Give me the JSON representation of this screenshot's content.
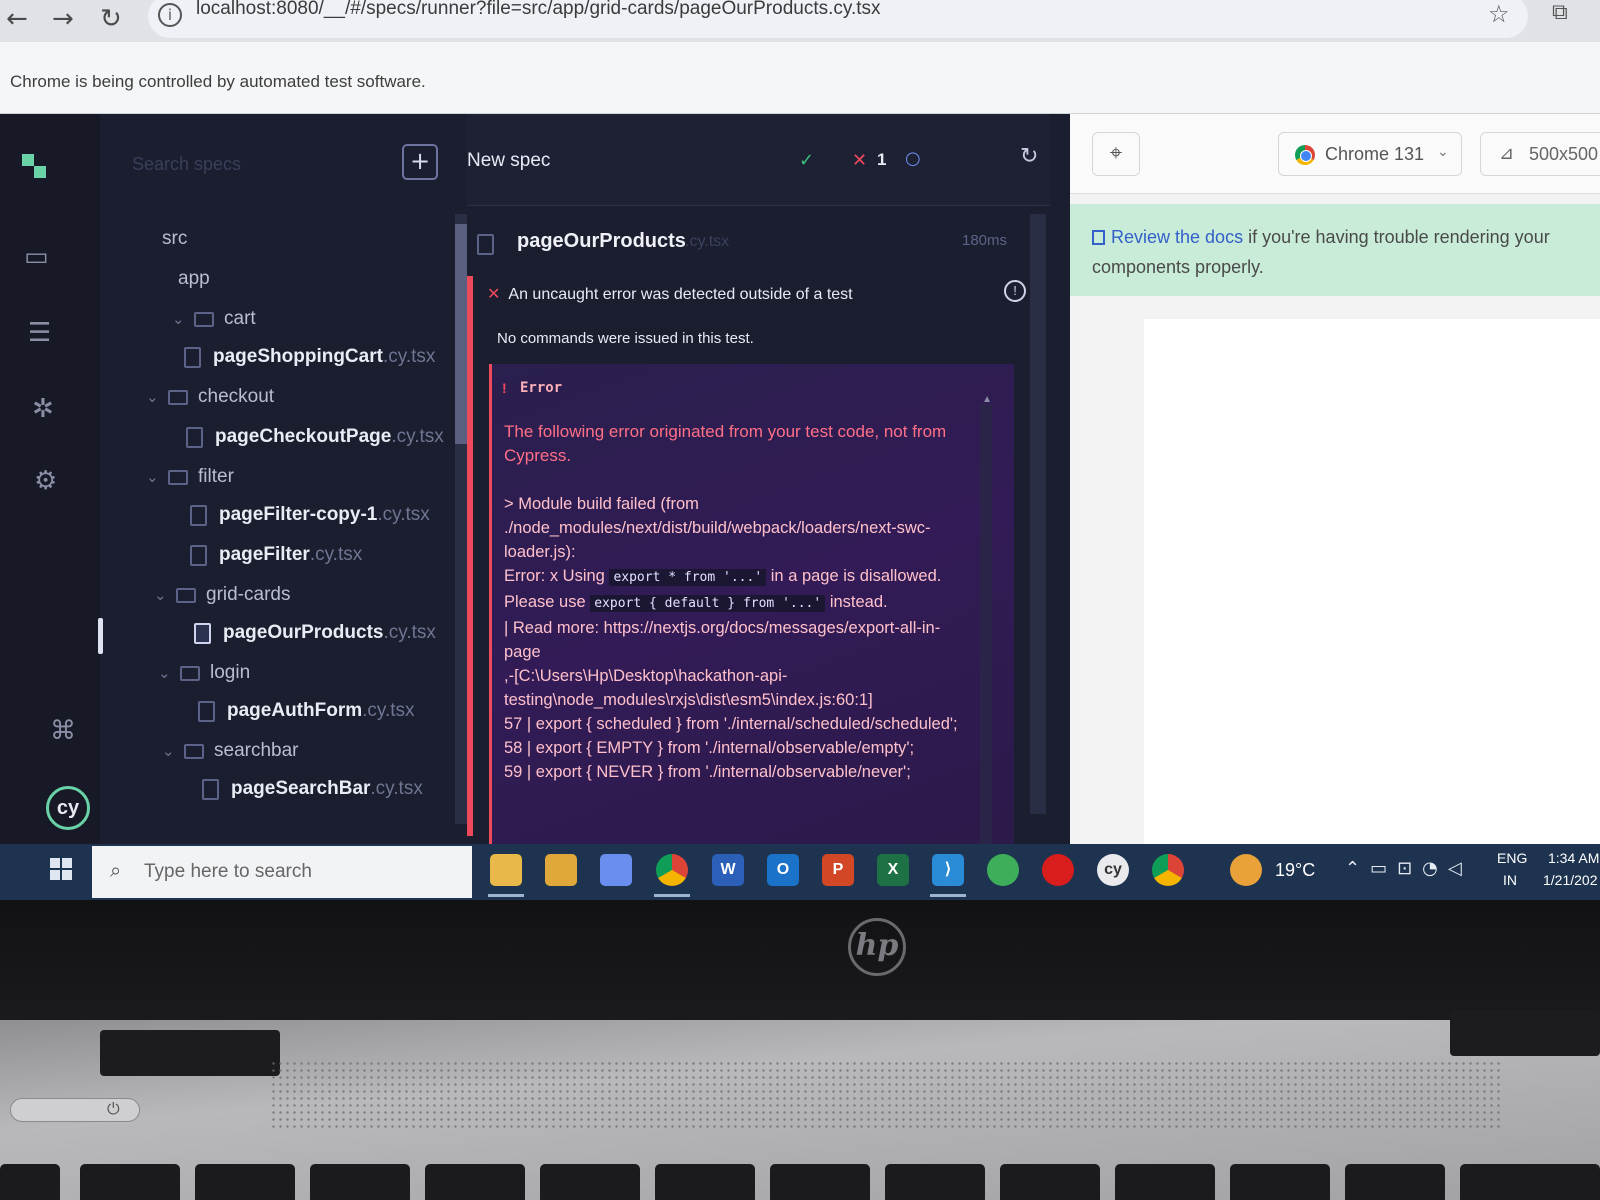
{
  "browser": {
    "url": "localhost:8080/__/#/specs/runner?file=src/app/grid-cards/pageOurProducts.cy.tsx",
    "automation_notice": "Chrome is being controlled by automated test software."
  },
  "cypress": {
    "search_placeholder": "Search specs",
    "new_spec_label": "New spec",
    "stats": {
      "passed_icon": "✓",
      "failed_icon": "✕",
      "failed_count": "1",
      "pending_icon": "○"
    },
    "tree": [
      {
        "type": "dir",
        "name": "src"
      },
      {
        "type": "dir",
        "name": "app"
      },
      {
        "type": "dir",
        "name": "cart"
      },
      {
        "type": "spec",
        "name": "pageShoppingCart",
        "ext": ".cy.tsx"
      },
      {
        "type": "dir",
        "name": "checkout"
      },
      {
        "type": "spec",
        "name": "pageCheckoutPage",
        "ext": ".cy.tsx"
      },
      {
        "type": "dir",
        "name": "filter"
      },
      {
        "type": "spec",
        "name": "pageFilter-copy-1",
        "ext": ".cy.tsx"
      },
      {
        "type": "spec",
        "name": "pageFilter",
        "ext": ".cy.tsx"
      },
      {
        "type": "dir",
        "name": "grid-cards"
      },
      {
        "type": "spec",
        "name": "pageOurProducts",
        "ext": ".cy.tsx",
        "active": true
      },
      {
        "type": "dir",
        "name": "login"
      },
      {
        "type": "spec",
        "name": "pageAuthForm",
        "ext": ".cy.tsx"
      },
      {
        "type": "dir",
        "name": "searchbar"
      },
      {
        "type": "spec",
        "name": "pageSearchBar",
        "ext": ".cy.tsx"
      }
    ],
    "reporter": {
      "spec_title": "pageOurProducts",
      "spec_title_ext": ".cy.tsx",
      "duration": "180ms",
      "uncaught": "An uncaught error was detected outside of a test",
      "no_commands": "No commands were issued in this test.",
      "error_label": "Error",
      "error_message": "The following error originated from your test code, not from Cypress.",
      "error_detail": {
        "l1": "> Module build failed (from ./node_modules/next/dist/build/webpack/loaders/next-swc-loader.js):",
        "l2": "Error:  x Using",
        "code1": "export * from '...'",
        "l3": "in a page is disallowed. Please use",
        "code2": "export { default } from '...'",
        "l4": "instead.",
        "l5": "| Read more: https://nextjs.org/docs/messages/export-all-in-page",
        "l6": ",-[C:\\Users\\Hp\\Desktop\\hackathon-api-testing\\node_modules\\rxjs\\dist\\esm5\\index.js:60:1]",
        "l7": "57 | export { scheduled } from './internal/scheduled/scheduled';",
        "l8": "58 | export { EMPTY } from './internal/observable/empty';",
        "l9": "59 | export { NEVER } from './internal/observable/never';"
      }
    }
  },
  "preview": {
    "browser_label": "Chrome 131",
    "viewport_label": "500x500",
    "docs_link": "Review the docs",
    "docs_rest": " if you're having trouble rendering your components properly."
  },
  "taskbar": {
    "search_placeholder": "Type here to search",
    "temperature": "19°C",
    "lang": "ENG",
    "region": "IN",
    "time": "1:34 AM",
    "date": "1/21/202"
  },
  "laptop": {
    "brand": "hp"
  }
}
